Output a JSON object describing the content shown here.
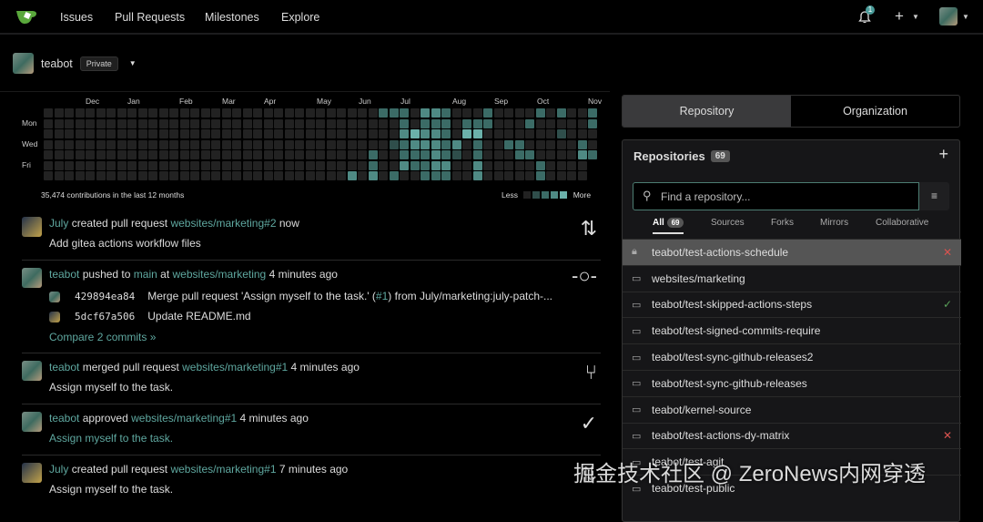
{
  "nav": {
    "items": [
      "Issues",
      "Pull Requests",
      "Milestones",
      "Explore"
    ],
    "notification_count": "1"
  },
  "context": {
    "name": "teabot",
    "visibility": "Private"
  },
  "heatmap": {
    "months": [
      "Dec",
      "Jan",
      "Feb",
      "Mar",
      "Apr",
      "May",
      "Jun",
      "Jul",
      "Aug",
      "Sep",
      "Oct",
      "Nov"
    ],
    "days": [
      "Mon",
      "Wed",
      "Fri"
    ],
    "summary": "35,474 contributions in the last 12 months",
    "less": "Less",
    "more": "More",
    "columns": 53,
    "active_cells": [
      [
        0,
        32,
        2
      ],
      [
        0,
        33,
        2
      ],
      [
        0,
        34,
        2
      ],
      [
        0,
        36,
        3
      ],
      [
        0,
        37,
        3
      ],
      [
        0,
        38,
        2
      ],
      [
        0,
        42,
        2
      ],
      [
        0,
        47,
        2
      ],
      [
        0,
        49,
        2
      ],
      [
        0,
        52,
        2
      ],
      [
        1,
        34,
        2
      ],
      [
        1,
        36,
        2
      ],
      [
        1,
        37,
        2
      ],
      [
        1,
        38,
        2
      ],
      [
        1,
        40,
        2
      ],
      [
        1,
        41,
        2
      ],
      [
        1,
        42,
        2
      ],
      [
        1,
        46,
        2
      ],
      [
        1,
        52,
        2
      ],
      [
        2,
        34,
        3
      ],
      [
        2,
        35,
        4
      ],
      [
        2,
        36,
        3
      ],
      [
        2,
        37,
        3
      ],
      [
        2,
        38,
        2
      ],
      [
        2,
        40,
        4
      ],
      [
        2,
        41,
        4
      ],
      [
        2,
        49,
        1
      ],
      [
        3,
        33,
        1
      ],
      [
        3,
        34,
        2
      ],
      [
        3,
        35,
        3
      ],
      [
        3,
        36,
        3
      ],
      [
        3,
        37,
        3
      ],
      [
        3,
        38,
        2
      ],
      [
        3,
        39,
        3
      ],
      [
        3,
        41,
        2
      ],
      [
        3,
        44,
        2
      ],
      [
        3,
        45,
        2
      ],
      [
        3,
        51,
        2
      ],
      [
        4,
        31,
        2
      ],
      [
        4,
        34,
        2
      ],
      [
        4,
        35,
        2
      ],
      [
        4,
        36,
        2
      ],
      [
        4,
        37,
        3
      ],
      [
        4,
        38,
        2
      ],
      [
        4,
        39,
        1
      ],
      [
        4,
        41,
        2
      ],
      [
        4,
        45,
        2
      ],
      [
        4,
        46,
        2
      ],
      [
        4,
        51,
        3
      ],
      [
        4,
        52,
        2
      ],
      [
        5,
        31,
        2
      ],
      [
        5,
        34,
        3
      ],
      [
        5,
        35,
        2
      ],
      [
        5,
        36,
        2
      ],
      [
        5,
        37,
        3
      ],
      [
        5,
        38,
        3
      ],
      [
        5,
        41,
        3
      ],
      [
        5,
        47,
        2
      ],
      [
        6,
        29,
        3
      ],
      [
        6,
        31,
        3
      ],
      [
        6,
        33,
        2
      ],
      [
        6,
        36,
        2
      ],
      [
        6,
        37,
        2
      ],
      [
        6,
        38,
        2
      ],
      [
        6,
        41,
        3
      ],
      [
        6,
        47,
        2
      ]
    ]
  },
  "feed": [
    {
      "user": "July",
      "action": "created pull request",
      "target": "websites/marketing#2",
      "time": "now",
      "detail": "Add gitea actions workflow files"
    },
    {
      "user": "teabot",
      "action": "pushed to",
      "branch": "main",
      "at": "at",
      "target": "websites/marketing",
      "time": "4 minutes ago",
      "commits": [
        {
          "sha": "429894ea84",
          "msg_pre": "Merge pull request 'Assign myself to the task.' (",
          "msg_link": "#1",
          "msg_post": ") from July/marketing:july-patch-..."
        },
        {
          "sha": "5dcf67a506",
          "msg_pre": "Update README.md",
          "msg_link": "",
          "msg_post": ""
        }
      ],
      "compare": "Compare 2 commits »"
    },
    {
      "user": "teabot",
      "action": "merged pull request",
      "target": "websites/marketing#1",
      "time": "4 minutes ago",
      "detail": "Assign myself to the task."
    },
    {
      "user": "teabot",
      "action": "approved",
      "target": "websites/marketing#1",
      "time": "4 minutes ago",
      "detail": "Assign myself to the task."
    },
    {
      "user": "July",
      "action": "created pull request",
      "target": "websites/marketing#1",
      "time": "7 minutes ago",
      "detail": "Assign myself to the task."
    }
  ],
  "panel": {
    "tabs": [
      "Repository",
      "Organization"
    ],
    "title": "Repositories",
    "count": "69",
    "search_placeholder": "Find a repository...",
    "filters": [
      "All",
      "Sources",
      "Forks",
      "Mirrors",
      "Collaborative"
    ],
    "all_count": "69",
    "repos": [
      {
        "name": "teabot/test-actions-schedule",
        "icon": "lock",
        "status": "fail"
      },
      {
        "name": "websites/marketing",
        "icon": "repo",
        "status": ""
      },
      {
        "name": "teabot/test-skipped-actions-steps",
        "icon": "repo",
        "status": "success"
      },
      {
        "name": "teabot/test-signed-commits-require",
        "icon": "repo",
        "status": ""
      },
      {
        "name": "teabot/test-sync-github-releases2",
        "icon": "repo",
        "status": ""
      },
      {
        "name": "teabot/test-sync-github-releases",
        "icon": "repo",
        "status": ""
      },
      {
        "name": "teabot/kernel-source",
        "icon": "repo",
        "status": ""
      },
      {
        "name": "teabot/test-actions-dy-matrix",
        "icon": "repo",
        "status": "fail"
      },
      {
        "name": "teabot/test-agit",
        "icon": "repo",
        "status": ""
      },
      {
        "name": "teabot/test-public",
        "icon": "repo",
        "status": ""
      }
    ]
  },
  "watermark": "掘金技术社区 @ ZeroNews内网穿透",
  "colors": {
    "accent": "#5fa8a0",
    "fail": "#d9534f",
    "success": "#5aa25a"
  }
}
